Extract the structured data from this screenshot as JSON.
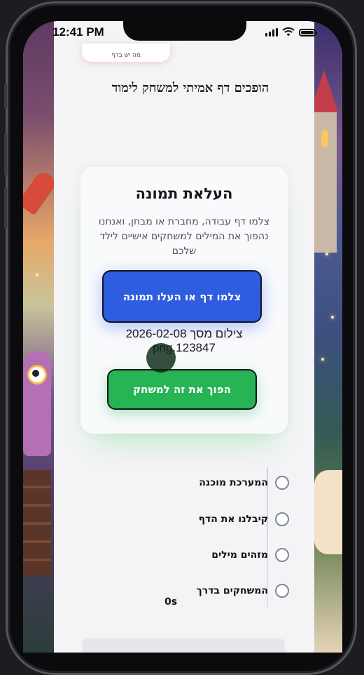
{
  "status_bar": {
    "time": "12:41 PM"
  },
  "top_pill": {
    "text": "מה יש בדף"
  },
  "headline": "הופכים דף אמיתי למשחק לימוד",
  "upload_card": {
    "title": "העלאת תמונה",
    "description": "צלמו דף עבודה, מחברת או מבחן, ואנחנו נהפוך את המילים למשחקים אישיים לילד שלכם",
    "upload_button_label": "צלמו דף או העלו תמונה",
    "file_name": "צילום מסך 2026-02-08 png.123847",
    "convert_button_label": "הפוך את זה למשחק"
  },
  "progress_steps": [
    {
      "label": "המערכת מוכנה"
    },
    {
      "label": "קיבלנו את הדף"
    },
    {
      "label": "מזהים מילים"
    },
    {
      "label": "המשחקים בדרך"
    }
  ],
  "timer": "0s",
  "colors": {
    "upload_button": "#2f5de0",
    "convert_button": "#26b454",
    "page_background": "#f4f4f6"
  },
  "icons": [
    "signal-icon",
    "wifi-icon",
    "battery-icon",
    "step-circle-icon"
  ]
}
